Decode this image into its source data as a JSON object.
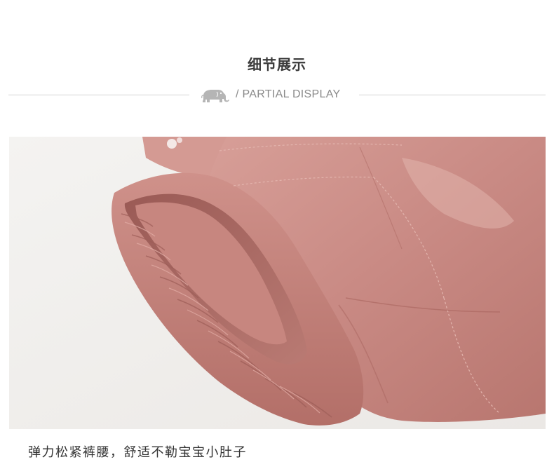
{
  "section": {
    "title": "细节展示",
    "subtitle": "/ PARTIAL DISPLAY"
  },
  "icons": {
    "divider_icon": "elephant-icon"
  },
  "photo": {
    "subject": "pink pants elastic waistband cuff",
    "colors": {
      "fabric": "#c98a84",
      "fabric_dark": "#a9655f",
      "fabric_light": "#e2b1a9",
      "background": "#f2f0ee"
    }
  },
  "caption": "弹力松紧裤腰，舒适不勒宝宝小肚子"
}
